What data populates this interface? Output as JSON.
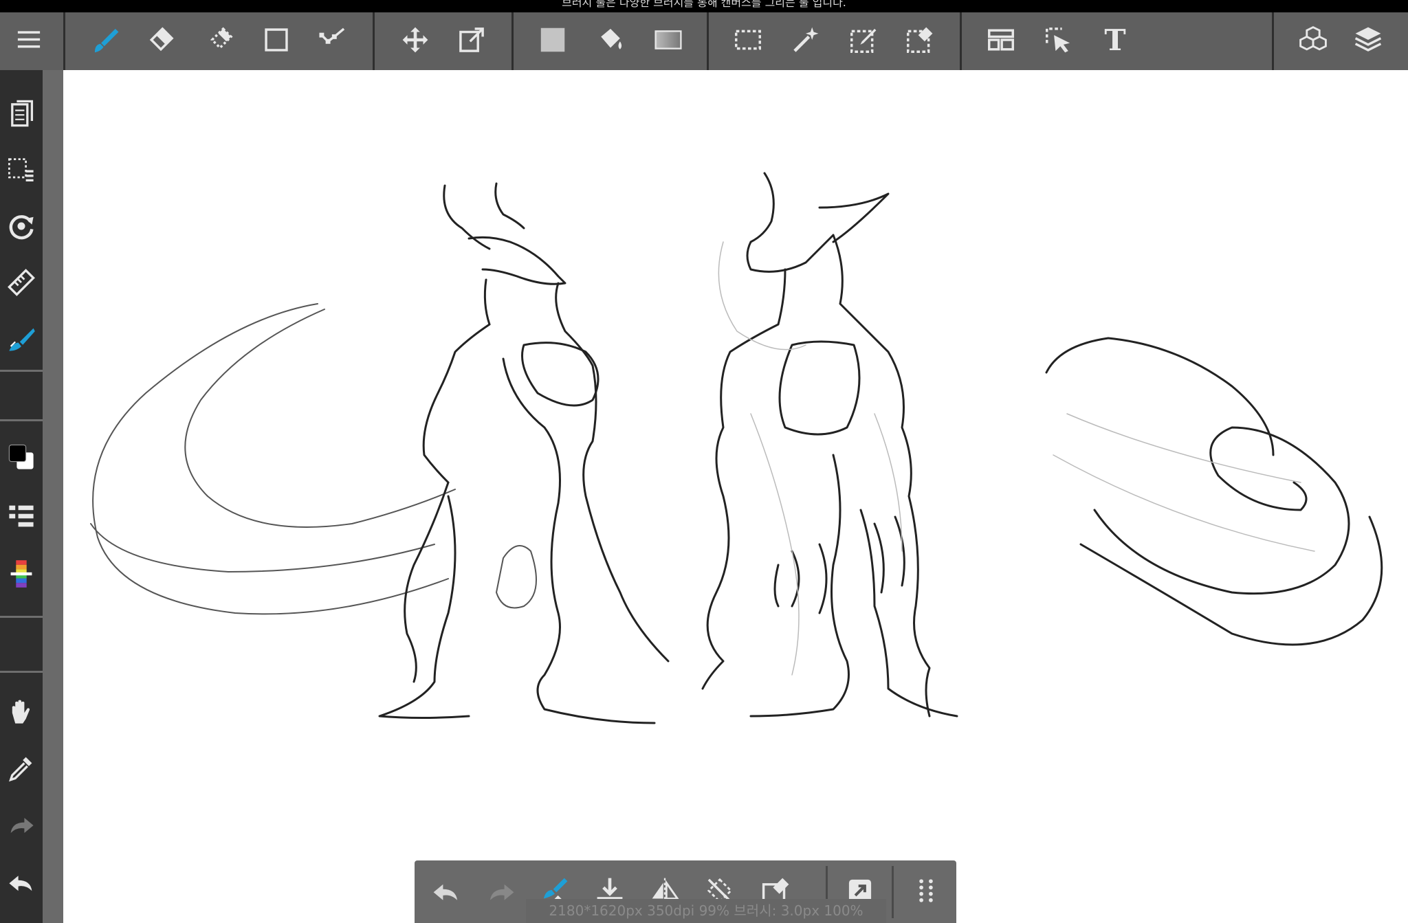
{
  "top_message": "브러시 툴은 다양한 브러시를 통해 캔버스를 그리는 툴 입니다.",
  "toolbar": {
    "tools": [
      {
        "name": "menu-icon"
      },
      {
        "name": "brush-icon",
        "active": true
      },
      {
        "name": "eraser-icon"
      },
      {
        "name": "blur-eraser-icon"
      },
      {
        "name": "rectangle-shape-icon"
      },
      {
        "name": "dot-line-icon"
      },
      {
        "name": "move-icon"
      },
      {
        "name": "transform-icon"
      },
      {
        "name": "fill-icon"
      },
      {
        "name": "bucket-icon"
      },
      {
        "name": "gradient-icon"
      },
      {
        "name": "select-rect-icon"
      },
      {
        "name": "magic-wand-icon"
      },
      {
        "name": "select-pen-icon"
      },
      {
        "name": "select-eraser-icon"
      },
      {
        "name": "frame-divide-icon"
      },
      {
        "name": "operation-icon"
      },
      {
        "name": "text-icon"
      },
      {
        "name": "material-icon"
      },
      {
        "name": "layer-icon"
      }
    ],
    "text_tool_label": "T"
  },
  "left_tools": [
    "page-manager-icon",
    "selection-tool-icon",
    "rotate-canvas-icon",
    "ruler-icon",
    "brush-settings-icon",
    "color-icon",
    "layer-list-icon",
    "color-palette-icon",
    "hand-icon",
    "eyedropper-icon",
    "redo-icon",
    "undo-icon"
  ],
  "colors": {
    "accent": "#1e9fd6",
    "primary_color": "#000000",
    "secondary_color": "#ffffff"
  },
  "bottom_toolbar": {
    "status": "2180*1620px 350dpi 99% 브러시: 3.0px 100%"
  }
}
